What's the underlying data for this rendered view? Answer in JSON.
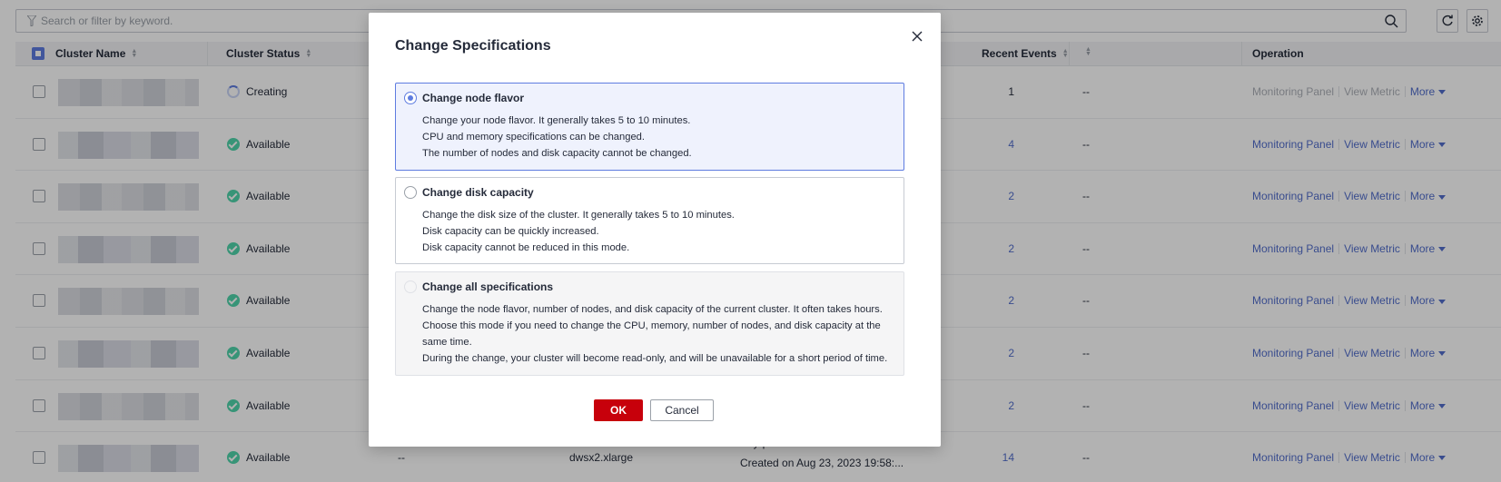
{
  "search": {
    "placeholder": "Search or filter by keyword."
  },
  "table": {
    "columns": {
      "cluster_name": "Cluster Name",
      "cluster_status": "Cluster Status",
      "recent_events": "Recent Events",
      "operation": "Operation"
    },
    "rows": [
      {
        "status": "Creating",
        "status_type": "creating",
        "events": "1",
        "events_link": false,
        "dash": "--",
        "ops_enabled": false
      },
      {
        "status": "Available",
        "status_type": "available",
        "events": "4",
        "events_link": true,
        "dash": "--",
        "ops_enabled": true
      },
      {
        "status": "Available",
        "status_type": "available",
        "events": "2",
        "events_link": true,
        "dash": "--",
        "ops_enabled": true
      },
      {
        "status": "Available",
        "status_type": "available",
        "events": "2",
        "events_link": true,
        "dash": "--",
        "ops_enabled": true
      },
      {
        "status": "Available",
        "status_type": "available",
        "events": "2",
        "events_link": true,
        "dash": "--",
        "ops_enabled": true
      },
      {
        "status": "Available",
        "status_type": "available",
        "events": "2",
        "events_link": true,
        "dash": "--",
        "ops_enabled": true
      },
      {
        "status": "Available",
        "status_type": "available",
        "events": "2",
        "events_link": true,
        "dash": "--",
        "ops_enabled": true
      },
      {
        "status": "Available",
        "status_type": "available",
        "events": "14",
        "events_link": true,
        "dash": "--",
        "ops_enabled": true
      }
    ],
    "last_row_extra": {
      "col_dash": "--",
      "flavor": "dwsx2.xlarge",
      "billing": "Pay-per-Use",
      "created": "Created on Aug 23, 2023 19:58:..."
    },
    "ops": {
      "monitoring": "Monitoring Panel",
      "view_metric": "View Metric",
      "more": "More"
    }
  },
  "modal": {
    "title": "Change Specifications",
    "options": [
      {
        "title": "Change node flavor",
        "lines": [
          "Change your node flavor. It generally takes 5 to 10 minutes.",
          "CPU and memory specifications can be changed.",
          "The number of nodes and disk capacity cannot be changed."
        ]
      },
      {
        "title": "Change disk capacity",
        "lines": [
          "Change the disk size of the cluster. It generally takes 5 to 10 minutes.",
          "Disk capacity can be quickly increased.",
          "Disk capacity cannot be reduced in this mode."
        ]
      },
      {
        "title": "Change all specifications",
        "lines": [
          "Change the node flavor, number of nodes, and disk capacity of the current cluster. It often takes hours.",
          "Choose this mode if you need to change the CPU, memory, number of nodes, and disk capacity at the same time.",
          "During the change, your cluster will become read-only, and will be unavailable for a short period of time."
        ]
      }
    ],
    "ok_label": "OK",
    "cancel_label": "Cancel"
  },
  "colors": {
    "accent": "#5e7ce0",
    "link": "#526ecc",
    "primary_button": "#c7000b",
    "available": "#50d4ab"
  }
}
